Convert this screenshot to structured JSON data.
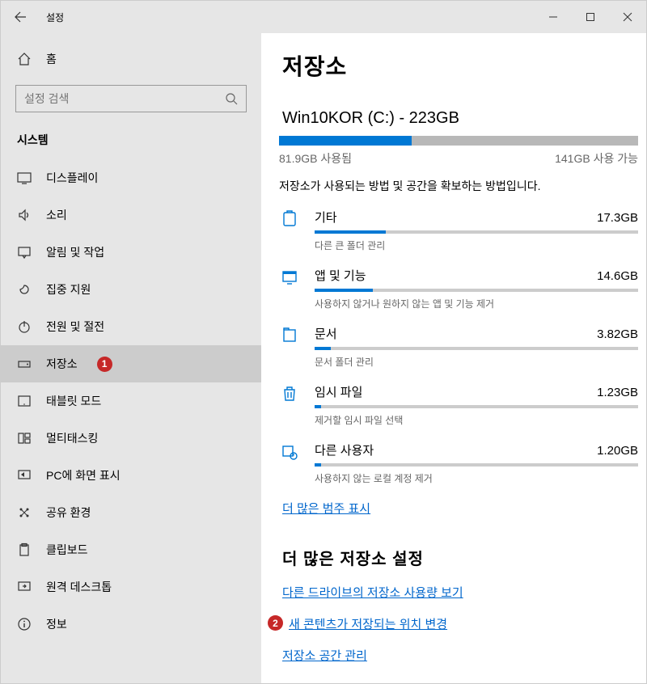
{
  "titlebar": {
    "title": "설정"
  },
  "sidebar": {
    "home": "홈",
    "search_placeholder": "설정 검색",
    "section": "시스템",
    "items": [
      {
        "label": "디스플레이"
      },
      {
        "label": "소리"
      },
      {
        "label": "알림 및 작업"
      },
      {
        "label": "집중 지원"
      },
      {
        "label": "전원 및 절전"
      },
      {
        "label": "저장소"
      },
      {
        "label": "태블릿 모드"
      },
      {
        "label": "멀티태스킹"
      },
      {
        "label": "PC에 화면 표시"
      },
      {
        "label": "공유 환경"
      },
      {
        "label": "클립보드"
      },
      {
        "label": "원격 데스크톱"
      },
      {
        "label": "정보"
      }
    ]
  },
  "main": {
    "title": "저장소",
    "drive": "Win10KOR (C:) - 223GB",
    "used_label": "81.9GB 사용됨",
    "free_label": "141GB 사용 가능",
    "used_pct": 37,
    "desc": "저장소가 사용되는 방법 및 공간을 확보하는 방법입니다.",
    "categories": [
      {
        "title": "기타",
        "size": "17.3GB",
        "pct": 22,
        "sub": "다른 큰 폴더 관리"
      },
      {
        "title": "앱 및 기능",
        "size": "14.6GB",
        "pct": 18,
        "sub": "사용하지 않거나 원하지 않는 앱 및 기능 제거"
      },
      {
        "title": "문서",
        "size": "3.82GB",
        "pct": 5,
        "sub": "문서 폴더 관리"
      },
      {
        "title": "임시 파일",
        "size": "1.23GB",
        "pct": 2,
        "sub": "제거할 임시 파일 선택"
      },
      {
        "title": "다른 사용자",
        "size": "1.20GB",
        "pct": 2,
        "sub": "사용하지 않는 로컬 계정 제거"
      }
    ],
    "show_more": "더 많은 범주 표시",
    "more_header": "더 많은 저장소 설정",
    "links": [
      "다른 드라이브의 저장소 사용량 보기",
      "새 콘텐츠가 저장되는 위치 변경",
      "저장소 공간 관리"
    ]
  },
  "markers": {
    "one": "1",
    "two": "2"
  }
}
